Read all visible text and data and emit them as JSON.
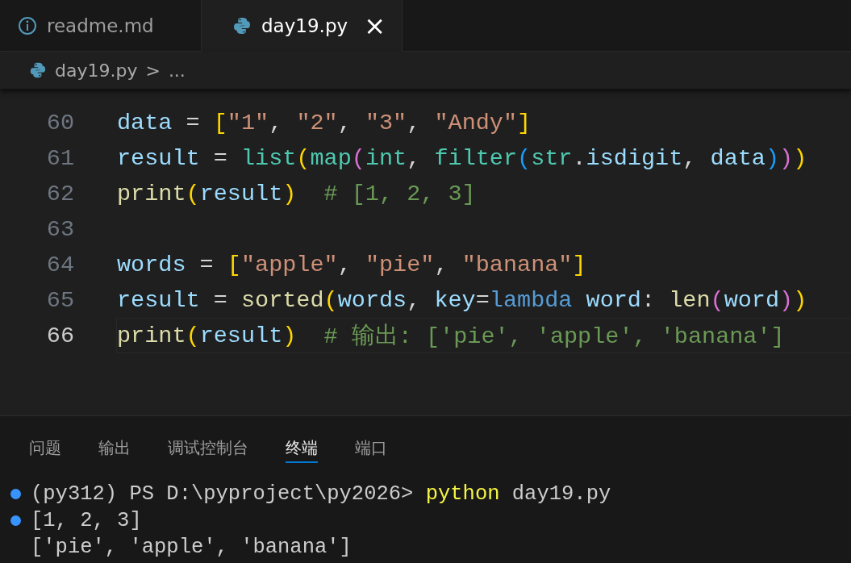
{
  "tabs": [
    {
      "label": "readme.md",
      "kind": "info",
      "selected": false,
      "closable": false
    },
    {
      "label": "day19.py",
      "kind": "python",
      "selected": true,
      "closable": true
    }
  ],
  "tab_close": "×",
  "breadcrumb": {
    "file": "day19.py",
    "separator": ">",
    "rest": "..."
  },
  "editor": {
    "lines": [
      {
        "number": "60",
        "current": false,
        "tokens": [
          {
            "kind": "var",
            "text": "data"
          },
          {
            "kind": "op",
            "text": " = "
          },
          {
            "kind": "b1",
            "text": "["
          },
          {
            "kind": "str",
            "text": "\"1\""
          },
          {
            "kind": "op",
            "text": ", "
          },
          {
            "kind": "str",
            "text": "\"2\""
          },
          {
            "kind": "op",
            "text": ", "
          },
          {
            "kind": "str",
            "text": "\"3\""
          },
          {
            "kind": "op",
            "text": ", "
          },
          {
            "kind": "str",
            "text": "\"Andy\""
          },
          {
            "kind": "b1",
            "text": "]"
          }
        ]
      },
      {
        "number": "61",
        "current": false,
        "tokens": [
          {
            "kind": "var",
            "text": "result"
          },
          {
            "kind": "op",
            "text": " = "
          },
          {
            "kind": "class",
            "text": "list"
          },
          {
            "kind": "b1",
            "text": "("
          },
          {
            "kind": "class",
            "text": "map"
          },
          {
            "kind": "b2",
            "text": "("
          },
          {
            "kind": "class",
            "text": "int"
          },
          {
            "kind": "op",
            "text": ", "
          },
          {
            "kind": "class",
            "text": "filter"
          },
          {
            "kind": "b3",
            "text": "("
          },
          {
            "kind": "class",
            "text": "str"
          },
          {
            "kind": "op",
            "text": "."
          },
          {
            "kind": "var",
            "text": "isdigit"
          },
          {
            "kind": "op",
            "text": ", "
          },
          {
            "kind": "var",
            "text": "data"
          },
          {
            "kind": "b3",
            "text": ")"
          },
          {
            "kind": "b2",
            "text": ")"
          },
          {
            "kind": "b1",
            "text": ")"
          }
        ]
      },
      {
        "number": "62",
        "current": false,
        "tokens": [
          {
            "kind": "func",
            "text": "print"
          },
          {
            "kind": "b1",
            "text": "("
          },
          {
            "kind": "var",
            "text": "result"
          },
          {
            "kind": "b1",
            "text": ")"
          },
          {
            "kind": "comment",
            "text": "  # [1, 2, 3]"
          }
        ]
      },
      {
        "number": "63",
        "current": false
      },
      {
        "number": "64",
        "current": false,
        "tokens": [
          {
            "kind": "var",
            "text": "words"
          },
          {
            "kind": "op",
            "text": " = "
          },
          {
            "kind": "b1",
            "text": "["
          },
          {
            "kind": "str",
            "text": "\"apple\""
          },
          {
            "kind": "op",
            "text": ", "
          },
          {
            "kind": "str",
            "text": "\"pie\""
          },
          {
            "kind": "op",
            "text": ", "
          },
          {
            "kind": "str",
            "text": "\"banana\""
          },
          {
            "kind": "b1",
            "text": "]"
          }
        ]
      },
      {
        "number": "65",
        "current": false,
        "tokens": [
          {
            "kind": "var",
            "text": "result"
          },
          {
            "kind": "op",
            "text": " = "
          },
          {
            "kind": "func",
            "text": "sorted"
          },
          {
            "kind": "b1",
            "text": "("
          },
          {
            "kind": "var",
            "text": "words"
          },
          {
            "kind": "op",
            "text": ", "
          },
          {
            "kind": "var",
            "text": "key"
          },
          {
            "kind": "op",
            "text": "="
          },
          {
            "kind": "keyword",
            "text": "lambda "
          },
          {
            "kind": "var",
            "text": "word"
          },
          {
            "kind": "op",
            "text": ": "
          },
          {
            "kind": "func",
            "text": "len"
          },
          {
            "kind": "b2",
            "text": "("
          },
          {
            "kind": "var",
            "text": "word"
          },
          {
            "kind": "b2",
            "text": ")"
          },
          {
            "kind": "b1",
            "text": ")"
          }
        ]
      },
      {
        "number": "66",
        "current": true,
        "tokens": [
          {
            "kind": "func",
            "text": "print"
          },
          {
            "kind": "b1",
            "text": "("
          },
          {
            "kind": "var",
            "text": "result"
          },
          {
            "kind": "b1",
            "text": ")"
          },
          {
            "kind": "comment",
            "text": "  # 输出: ['pie', 'apple', 'banana']"
          }
        ]
      }
    ]
  },
  "panel_tabs": [
    {
      "label": "问题",
      "selected": false
    },
    {
      "label": "输出",
      "selected": false
    },
    {
      "label": "调试控制台",
      "selected": false
    },
    {
      "label": "终端",
      "selected": true
    },
    {
      "label": "端口",
      "selected": false
    }
  ],
  "terminal": [
    {
      "decorated": true,
      "segments": [
        {
          "kind": "text",
          "text": "(py312) PS D:\\pyproject\\py2026> "
        },
        {
          "kind": "command",
          "text": "python"
        },
        {
          "kind": "text",
          "text": " day19.py"
        }
      ]
    },
    {
      "decorated": true,
      "segments": [
        {
          "kind": "text",
          "text": "[1, 2, 3]"
        }
      ]
    },
    {
      "decorated": false,
      "segments": [
        {
          "kind": "text",
          "text": "['pie', 'apple', 'banana']"
        }
      ]
    }
  ]
}
